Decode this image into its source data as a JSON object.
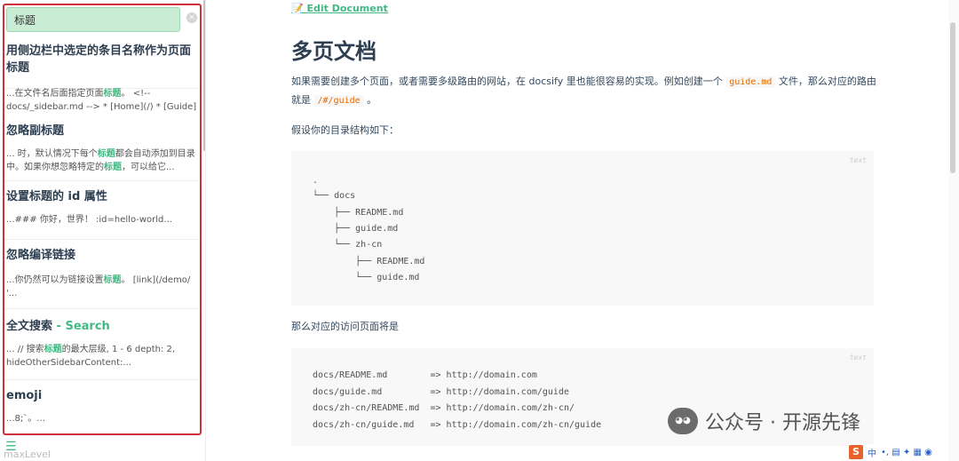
{
  "sidebar": {
    "search": {
      "value": "标题",
      "clear": "×"
    },
    "results": [
      {
        "title": "用侧边栏中选定的条目名称作为页面标题",
        "title_sub": "",
        "snippet_parts": [
          "...在文件名后面指定页面",
          "标题",
          "。 <!-- docs/_sidebar.md --> * [Home](/) * [Guide](gui..."
        ]
      },
      {
        "title": "忽略副标题",
        "title_sub": "",
        "snippet_parts": [
          "... 时，默认情况下每个",
          "标题",
          "都会自动添加到目录中。如果你想忽略特定的",
          "标题",
          "，可以给它..."
        ]
      },
      {
        "title": "设置标题的 id 属性",
        "title_sub": "",
        "snippet_parts": [
          "...### 你好，世界！ :id=hello-world..."
        ]
      },
      {
        "title": "忽略编译链接",
        "title_sub": "",
        "snippet_parts": [
          "...你仍然可以为链接设置",
          "标题",
          "。 [link](/demo/ '..."
        ]
      },
      {
        "title": "全文搜索",
        "title_sub": " - Search",
        "snippet_parts": [
          "... // 搜索",
          "标题",
          "的最大层级, 1 - 6 depth: 2, hideOtherSidebarContent:..."
        ]
      },
      {
        "title": "emoji",
        "title_sub": "",
        "snippet_parts": [
          "...8;`。..."
        ]
      }
    ],
    "menu_icon": "☰",
    "footer_text": "maxLevel"
  },
  "main": {
    "edit_link": "📝 Edit Document",
    "title": "多页文档",
    "intro_parts": [
      "如果需要创建多个页面，或者需要多级路由的网站，在 docsify 里也能很容易的实现。例如创建一个 ",
      "guide.md",
      " 文件，那么对应的路由就是 ",
      "/#/guide",
      " 。"
    ],
    "dir_intro": "假设你的目录结构如下：",
    "code1": {
      "lang": "text",
      "lines": [
        ".",
        "└── docs",
        "    ├── README.md",
        "    ├── guide.md",
        "    └── zh-cn",
        "        ├── README.md",
        "        └── guide.md"
      ]
    },
    "routes_intro": "那么对应的访问页面将是",
    "code2": {
      "lang": "text",
      "lines": [
        "docs/README.md        => http://domain.com",
        "docs/guide.md         => http://domain.com/guide",
        "docs/zh-cn/README.md  => http://domain.com/zh-cn/",
        "docs/zh-cn/guide.md   => http://domain.com/zh-cn/guide"
      ]
    }
  },
  "watermark": {
    "text": "公众号 · 开源先锋"
  },
  "ime": {
    "logo": "S",
    "lang": "中",
    "extra": "•, ▤ ✦ ▦ ◉"
  },
  "colors": {
    "accent": "#42b983",
    "highlight_border": "#d0303c",
    "inline_code": "#e96900"
  }
}
